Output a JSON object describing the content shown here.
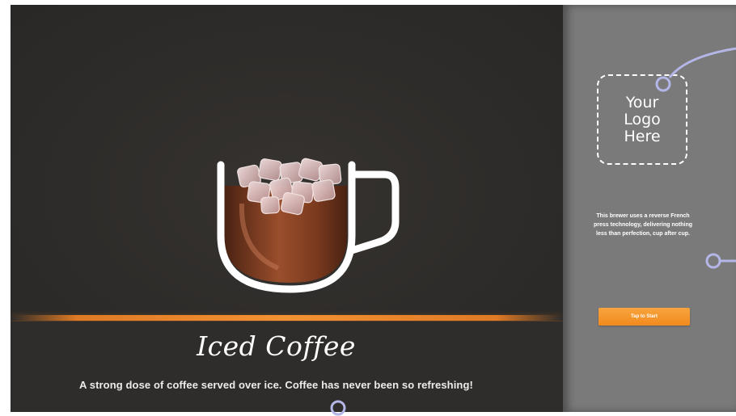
{
  "product": {
    "title": "Iced Coffee",
    "description": "A strong dose of coffee served over ice. Coffee has never been so refreshing!",
    "image_icon": "iced-coffee-cup-icon"
  },
  "sidebar": {
    "logo_text": "Your Logo Here",
    "brewer_text": "This brewer uses a reverse French press technology, delivering nothing less than perfection, cup after cup.",
    "start_button_label": "Tap to Start"
  },
  "colors": {
    "main_background": "#2e2c2a",
    "sidebar_background": "#7a7a7a",
    "accent_orange": "#f28a1e",
    "callout_lavender": "#b3b6e6"
  },
  "annotations": {
    "callout_markers": [
      "logo-callout-marker",
      "brewer-text-callout-marker",
      "description-callout-marker"
    ]
  }
}
